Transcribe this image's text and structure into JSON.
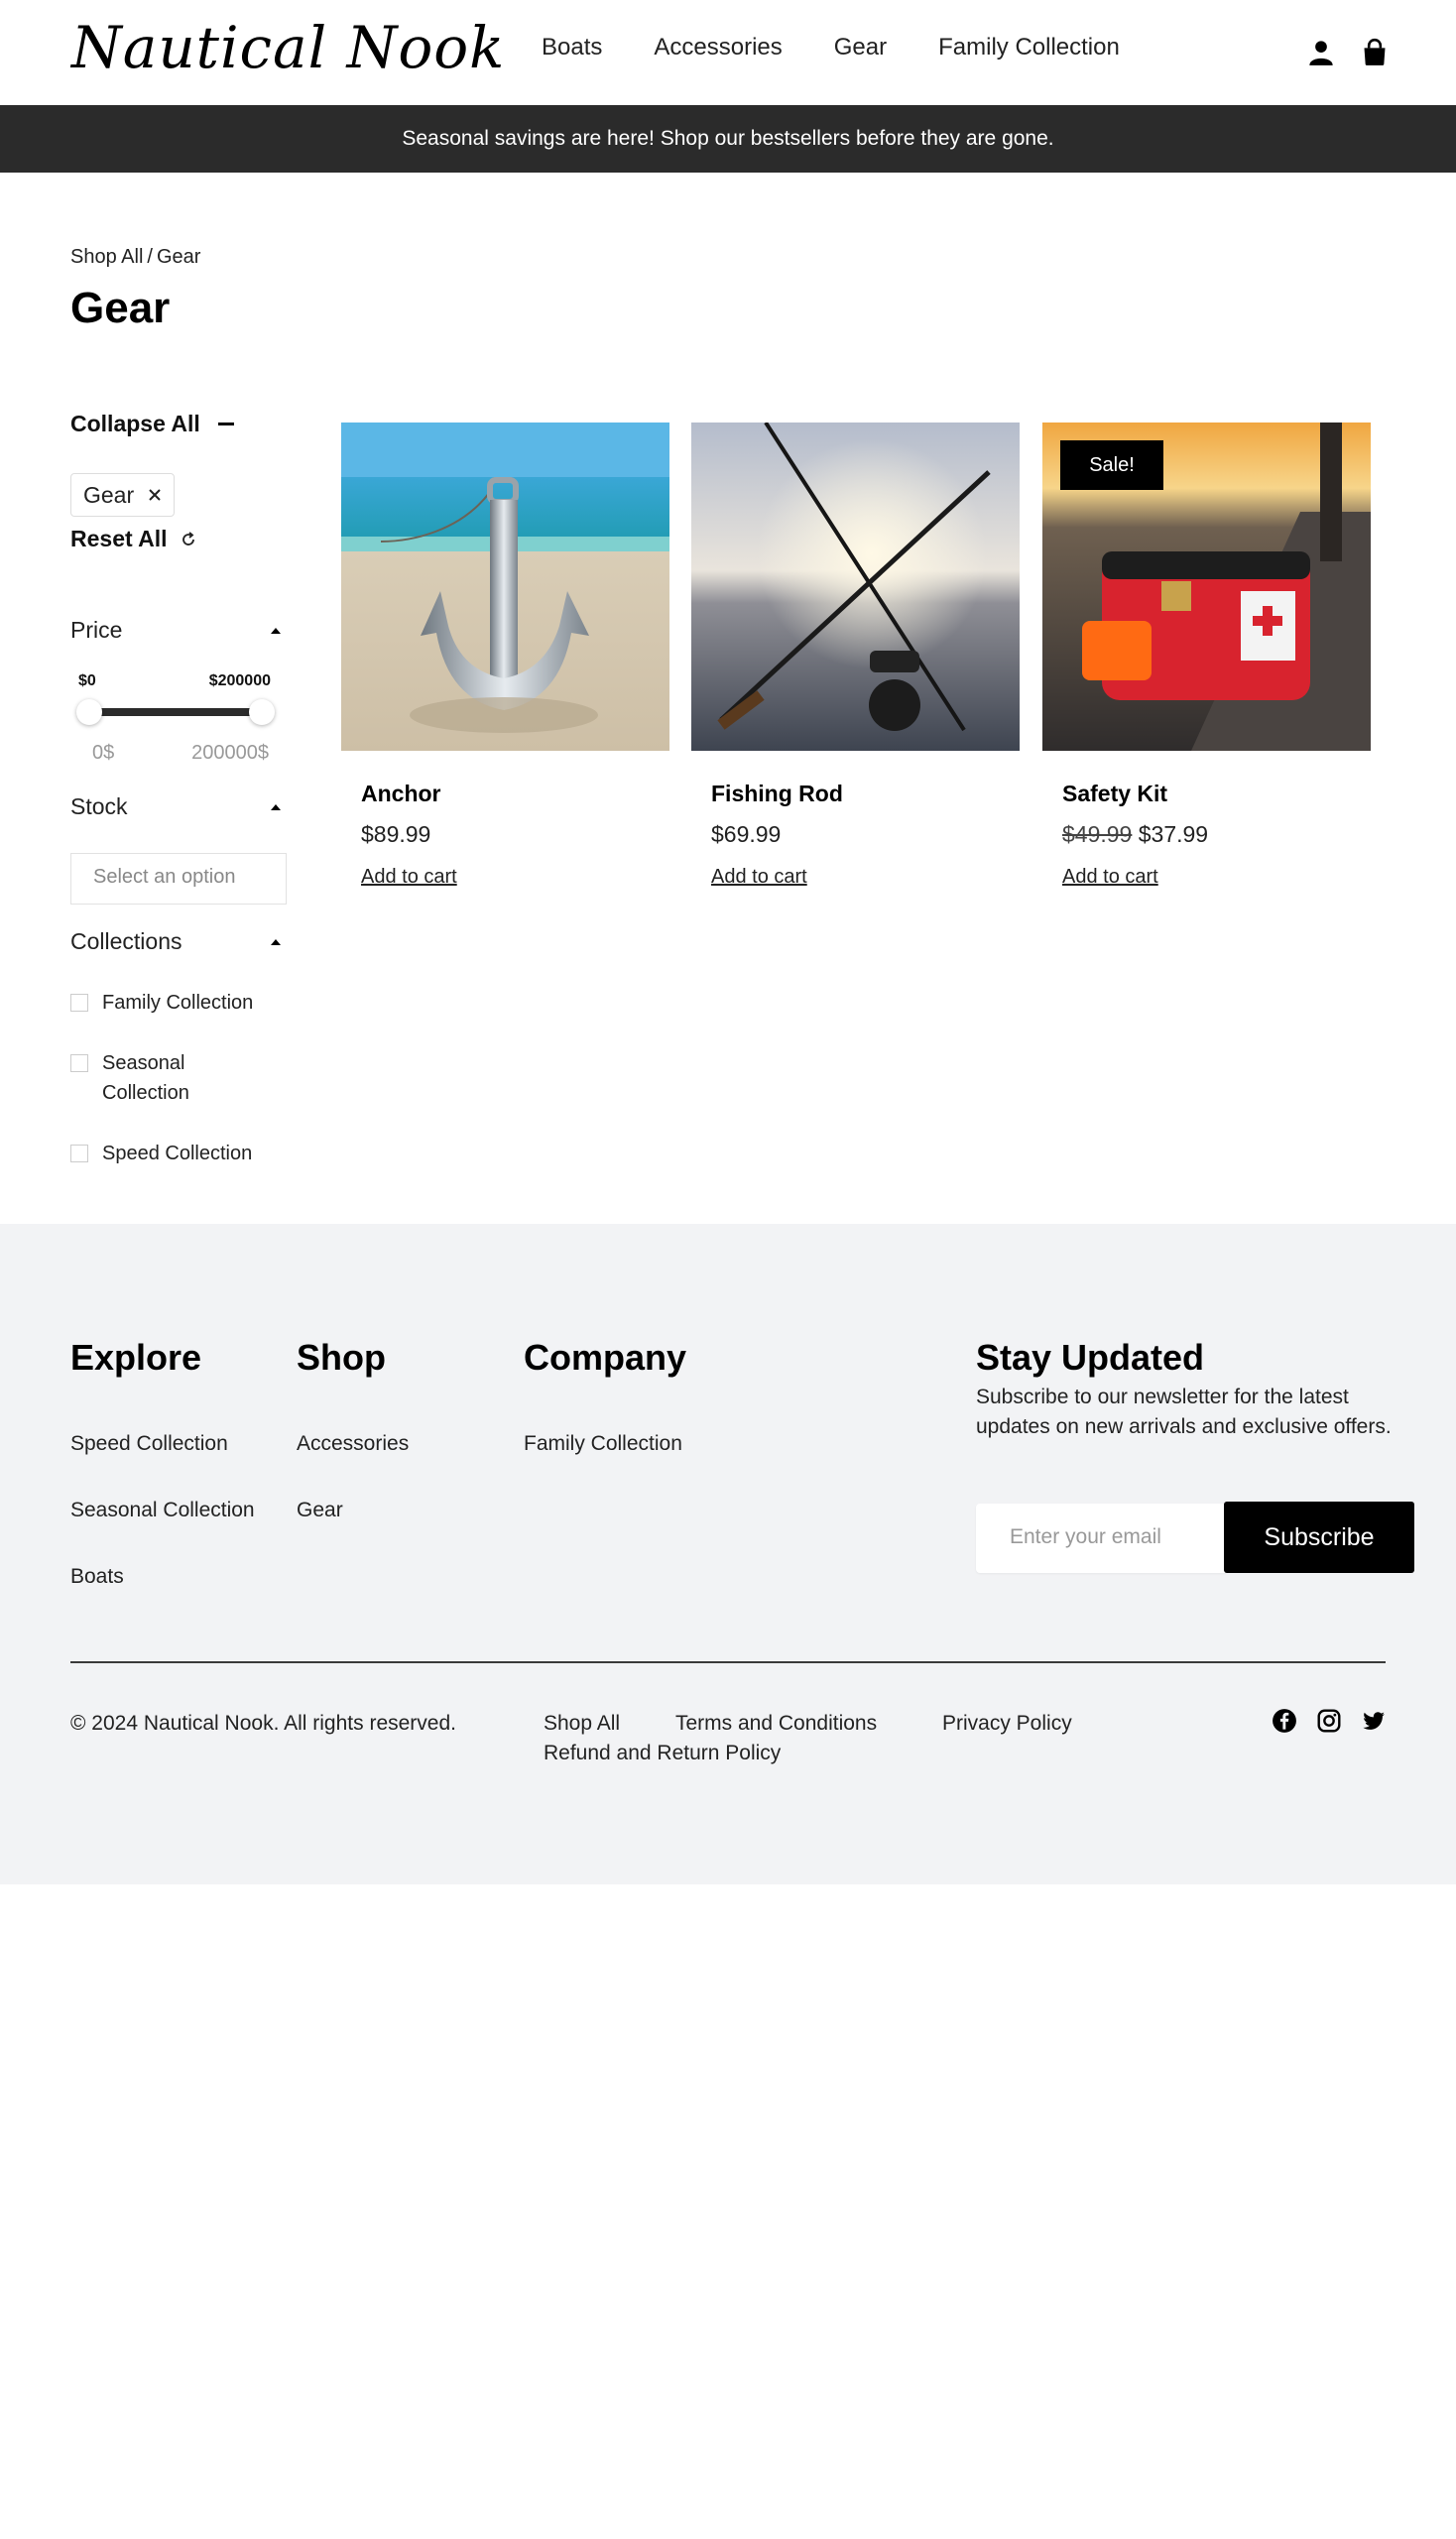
{
  "header": {
    "logo": "Nautical Nook",
    "nav": [
      "Boats",
      "Accessories",
      "Gear",
      "Family Collection"
    ],
    "icons": [
      "account-icon",
      "cart-icon"
    ]
  },
  "announcement": "Seasonal savings are here! Shop our bestsellers before they are gone.",
  "breadcrumb": {
    "root": "Shop All",
    "sep": "/",
    "current": "Gear"
  },
  "page_title": "Gear",
  "sidebar": {
    "collapse_all": "Collapse All",
    "active_filter": "Gear",
    "reset_all": "Reset All",
    "price": {
      "heading": "Price",
      "min_label": "$0",
      "max_label": "$200000",
      "min_value": "0$",
      "max_value": "200000$",
      "range_min": 0,
      "range_max": 200000
    },
    "stock": {
      "heading": "Stock",
      "placeholder": "Select an option"
    },
    "collections": {
      "heading": "Collections",
      "options": [
        "Family Collection",
        "Seasonal Collection",
        "Speed Collection"
      ]
    }
  },
  "products": [
    {
      "name": "Anchor",
      "price": "$89.99",
      "old_price": "",
      "cta": "Add to cart",
      "badge": ""
    },
    {
      "name": "Fishing Rod",
      "price": "$69.99",
      "old_price": "",
      "cta": "Add to cart",
      "badge": ""
    },
    {
      "name": "Safety Kit",
      "price": "$37.99",
      "old_price": "$49.99",
      "cta": "Add to cart",
      "badge": "Sale!"
    }
  ],
  "footer": {
    "explore": {
      "heading": "Explore",
      "links": [
        "Speed Collection",
        "Seasonal Collection",
        "Boats"
      ]
    },
    "shop": {
      "heading": "Shop",
      "links": [
        "Accessories",
        "Gear"
      ]
    },
    "company": {
      "heading": "Company",
      "links": [
        "Family Collection"
      ]
    },
    "newsletter": {
      "heading": "Stay Updated",
      "text": "Subscribe to our newsletter for the latest updates on new arrivals and exclusive offers.",
      "placeholder": "Enter your email",
      "button": "Subscribe"
    },
    "copyright": "© 2024 Nautical Nook. All rights reserved.",
    "legal_links": [
      "Shop All",
      "Terms and Conditions",
      "Privacy Policy",
      "Refund and Return Policy"
    ],
    "social": [
      "facebook-icon",
      "instagram-icon",
      "twitter-icon"
    ]
  },
  "colors": {
    "announce_bg": "#2b2b2b",
    "footer_bg": "#f2f3f5",
    "accent": "#000000"
  }
}
